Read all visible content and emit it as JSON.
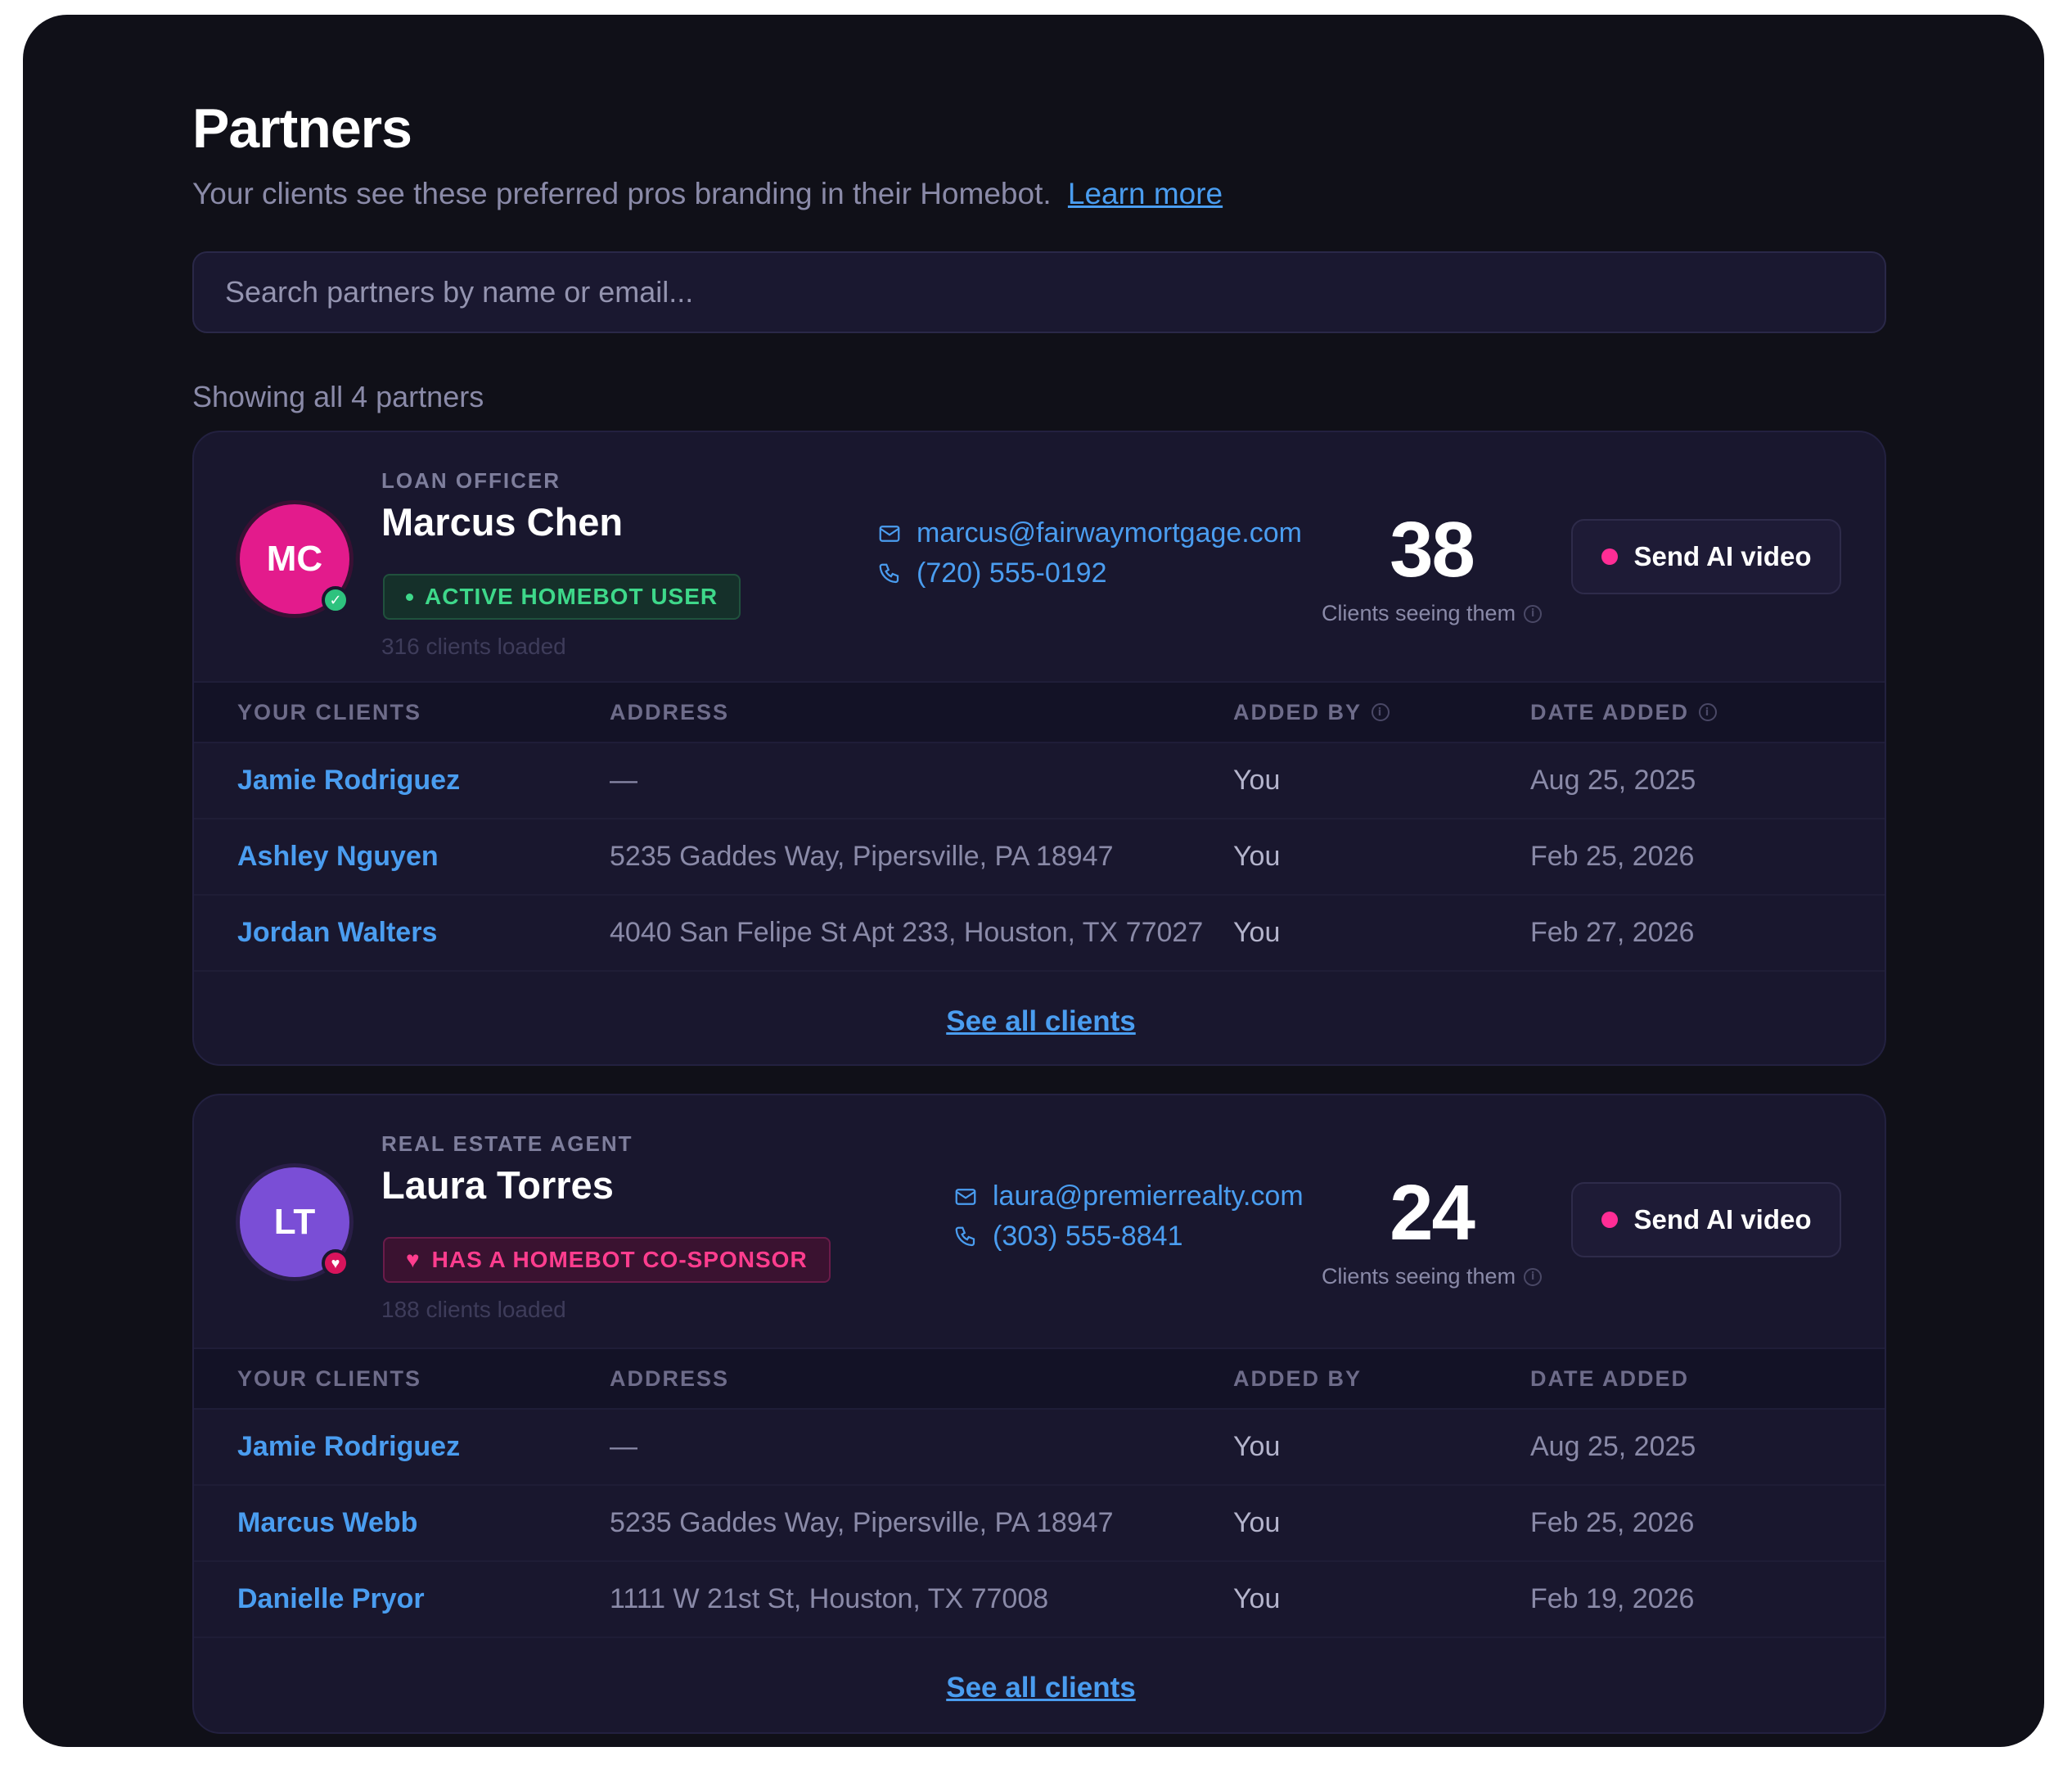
{
  "page": {
    "title": "Partners",
    "subtitle": "Your clients see these preferred pros branding in their Homebot.",
    "learn_more": "Learn more",
    "search_placeholder": "Search partners by name or email...",
    "count_text": "Showing all 4 partners"
  },
  "colors": {
    "background": "#101018",
    "card": "#19172e",
    "link": "#4a9df0",
    "accent_pink": "#ff2d95",
    "success_green": "#3ed88a"
  },
  "table_headers": {
    "clients": "YOUR CLIENTS",
    "address": "ADDRESS",
    "added_by": "ADDED BY",
    "date_added": "DATE ADDED"
  },
  "partners": [
    {
      "initials": "MC",
      "avatar_color": "#e31b8c",
      "role": "LOAN OFFICER",
      "name": "Marcus Chen",
      "badge": "ACTIVE HOMEBOT USER",
      "badge_icon": "status-dot-icon",
      "clients_loaded": "316 clients loaded",
      "email": "marcus@fairwaymortgage.com",
      "phone": "(720) 555-0192",
      "clients_seeing": "38",
      "clients_seeing_label": "Clients seeing them",
      "send_label": "Send AI video",
      "see_all_label": "See all clients",
      "clients": [
        {
          "name": "Jamie Rodriguez",
          "address": "—",
          "added_by": "You",
          "date": "Aug 25, 2025"
        },
        {
          "name": "Ashley Nguyen",
          "address": "5235 Gaddes Way, Pipersville, PA 18947",
          "added_by": "You",
          "date": "Feb 25, 2026"
        },
        {
          "name": "Jordan Walters",
          "address": "4040 San Felipe St Apt 233, Houston, TX 77027",
          "added_by": "You",
          "date": "Feb 27, 2026"
        }
      ]
    },
    {
      "initials": "LT",
      "avatar_color": "#7a4ed6",
      "role": "REAL ESTATE AGENT",
      "name": "Laura Torres",
      "badge": "HAS A HOMEBOT CO-SPONSOR",
      "badge_icon": "heart-icon",
      "clients_loaded": "188 clients loaded",
      "email": "laura@premierrealty.com",
      "phone": "(303) 555-8841",
      "clients_seeing": "24",
      "clients_seeing_label": "Clients seeing them",
      "send_label": "Send AI video",
      "see_all_label": "See all clients",
      "clients": [
        {
          "name": "Jamie Rodriguez",
          "address": "—",
          "added_by": "You",
          "date": "Aug 25, 2025"
        },
        {
          "name": "Marcus Webb",
          "address": "5235 Gaddes Way, Pipersville, PA 18947",
          "added_by": "You",
          "date": "Feb 25, 2026"
        },
        {
          "name": "Danielle Pryor",
          "address": "1111 W 21st St, Houston, TX 77008",
          "added_by": "You",
          "date": "Feb 19, 2026"
        }
      ]
    }
  ]
}
